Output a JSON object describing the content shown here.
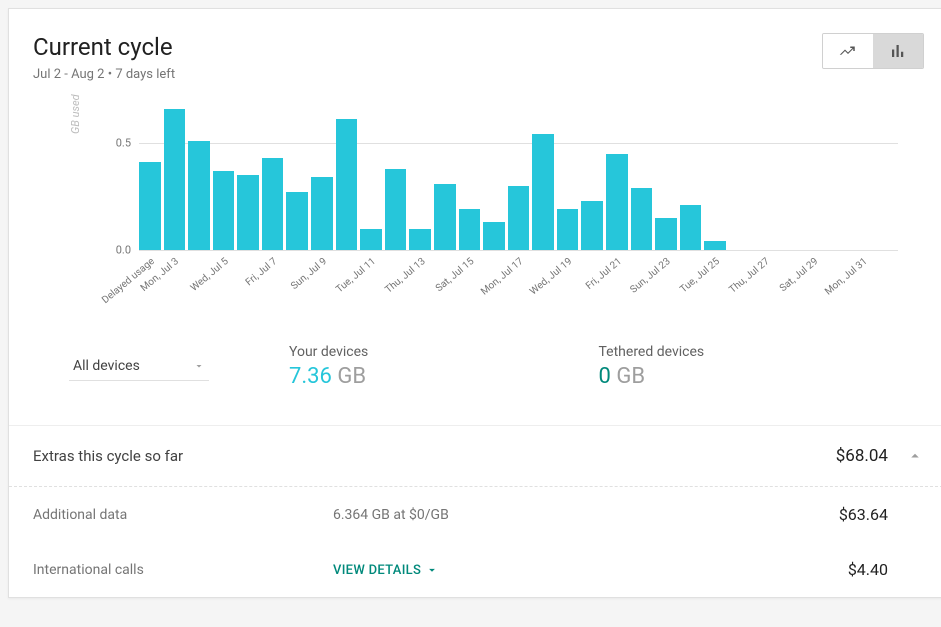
{
  "header": {
    "title": "Current cycle",
    "subtitle": "Jul 2 - Aug 2 • 7 days left"
  },
  "chart_data": {
    "type": "bar",
    "ylabel": "GB used",
    "ylim": [
      0,
      0.7
    ],
    "yticks": [
      0.0,
      0.5
    ],
    "categories": [
      "Delayed usage",
      "Mon, Jul 3",
      "",
      "Wed, Jul 5",
      "",
      "Fri, Jul 7",
      "",
      "Sun, Jul 9",
      "",
      "Tue, Jul 11",
      "",
      "Thu, Jul 13",
      "",
      "Sat, Jul 15",
      "",
      "Mon, Jul 17",
      "",
      "Wed, Jul 19",
      "",
      "Fri, Jul 21",
      "",
      "Sun, Jul 23",
      "",
      "Tue, Jul 25",
      "",
      "Thu, Jul 27",
      "",
      "Sat, Jul 29",
      "",
      "Mon, Jul 31",
      ""
    ],
    "values": [
      0.41,
      0.66,
      0.51,
      0.37,
      0.35,
      0.43,
      0.27,
      0.34,
      0.61,
      0.1,
      0.38,
      0.1,
      0.31,
      0.19,
      0.13,
      0.3,
      0.54,
      0.19,
      0.23,
      0.45,
      0.29,
      0.15,
      0.21,
      0.04,
      0,
      0,
      0,
      0,
      0,
      0,
      0
    ]
  },
  "device_select": {
    "selected": "All devices"
  },
  "stats": {
    "your_devices_label": "Your devices",
    "your_devices_value": "7.36",
    "your_devices_unit": "GB",
    "tethered_label": "Tethered devices",
    "tethered_value": "0",
    "tethered_unit": "GB"
  },
  "extras": {
    "header_label": "Extras this cycle so far",
    "header_amount": "$68.04",
    "rows": [
      {
        "label": "Additional data",
        "detail": "6.364 GB at $0/GB",
        "amount": "$63.64"
      },
      {
        "label": "International calls",
        "detail_action": "VIEW DETAILS",
        "amount": "$4.40"
      }
    ]
  }
}
